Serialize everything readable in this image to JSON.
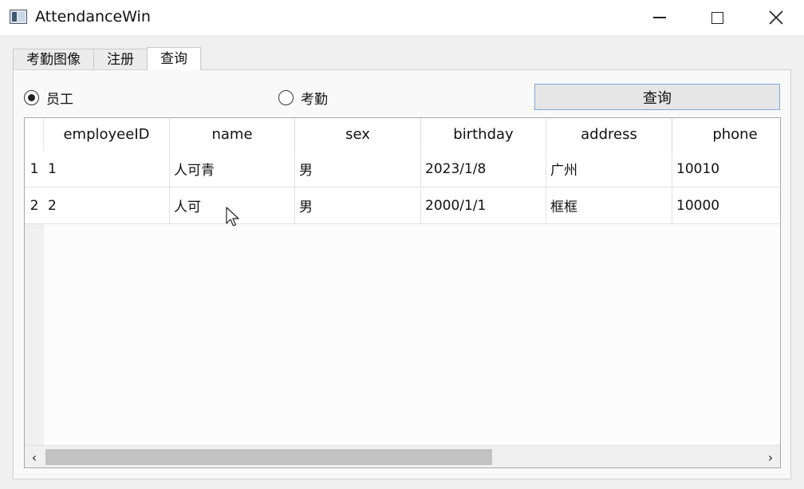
{
  "window": {
    "title": "AttendanceWin",
    "controls": {
      "minimize": "minimize-icon",
      "maximize": "maximize-icon",
      "close": "close-icon"
    }
  },
  "tabs": [
    {
      "label": "考勤图像",
      "active": false
    },
    {
      "label": "注册",
      "active": false
    },
    {
      "label": "查询",
      "active": true
    }
  ],
  "filter": {
    "options": [
      {
        "label": "员工",
        "checked": true
      },
      {
        "label": "考勤",
        "checked": false
      }
    ],
    "query_button": "查询"
  },
  "table": {
    "columns": [
      "employeeID",
      "name",
      "sex",
      "birthday",
      "address",
      "phone"
    ],
    "rows": [
      {
        "index": "1",
        "cells": [
          "1",
          "人可青",
          "男",
          "2023/1/8",
          "广州",
          "10010"
        ]
      },
      {
        "index": "2",
        "cells": [
          "2",
          "人可",
          "男",
          "2000/1/1",
          "框框",
          "10000"
        ]
      }
    ]
  },
  "scrollbar": {
    "left_arrow": "‹",
    "right_arrow": "›"
  },
  "colors": {
    "accent_border": "#7aa7d8",
    "button_bg": "#e6e6e6",
    "window_bg": "#f0f0f0"
  }
}
